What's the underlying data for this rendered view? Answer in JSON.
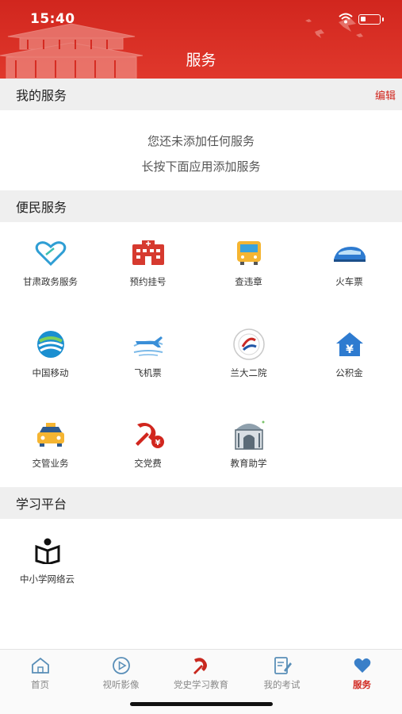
{
  "status_bar": {
    "time": "15:40",
    "battery_level": 0.25
  },
  "header": {
    "title": "服务"
  },
  "my_services": {
    "title": "我的服务",
    "edit_label": "编辑",
    "empty_line1": "您还未添加任何服务",
    "empty_line2": "长按下面应用添加服务"
  },
  "convenience": {
    "title": "便民服务",
    "items": [
      {
        "label": "甘肃政务服务",
        "icon": "heart-outline-icon"
      },
      {
        "label": "预约挂号",
        "icon": "hospital-icon"
      },
      {
        "label": "查违章",
        "icon": "bus-icon"
      },
      {
        "label": "火车票",
        "icon": "train-icon"
      },
      {
        "label": "中国移动",
        "icon": "china-mobile-icon"
      },
      {
        "label": "飞机票",
        "icon": "airplane-icon"
      },
      {
        "label": "兰大二院",
        "icon": "hospital-logo-icon"
      },
      {
        "label": "公积金",
        "icon": "housing-fund-icon"
      },
      {
        "label": "交管业务",
        "icon": "taxi-icon"
      },
      {
        "label": "交党费",
        "icon": "party-fee-icon"
      },
      {
        "label": "教育助学",
        "icon": "school-building-icon"
      }
    ]
  },
  "learning": {
    "title": "学习平台",
    "items": [
      {
        "label": "中小学网络云",
        "icon": "reading-person-icon"
      }
    ]
  },
  "tabbar": {
    "tabs": [
      {
        "label": "首页",
        "icon": "home-icon",
        "active": false
      },
      {
        "label": "视听影像",
        "icon": "play-icon",
        "active": false
      },
      {
        "label": "党史学习教育",
        "icon": "party-emblem-icon",
        "active": false
      },
      {
        "label": "我的考试",
        "icon": "exam-icon",
        "active": false
      },
      {
        "label": "服务",
        "icon": "heart-icon",
        "active": true
      }
    ]
  },
  "colors": {
    "brand_red": "#d1261e",
    "section_bg": "#efefef",
    "tab_inactive": "#888888"
  }
}
